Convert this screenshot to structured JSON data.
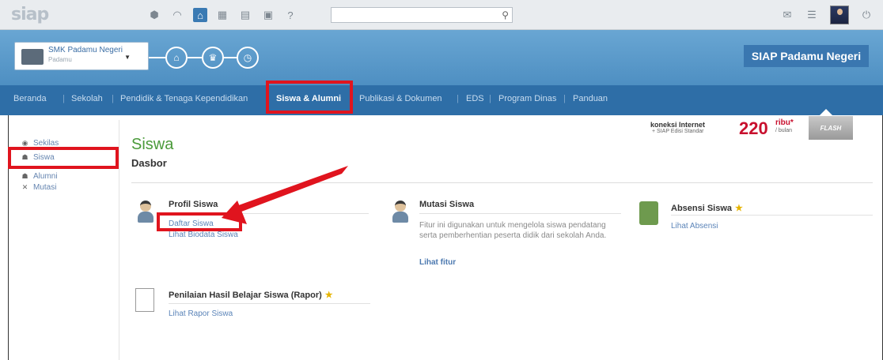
{
  "topbar": {
    "logo": "siap",
    "icons": [
      "cube-icon",
      "rss-icon",
      "org-icon",
      "grid-icon",
      "table-icon",
      "calendar-icon",
      "help-icon"
    ],
    "search_placeholder": "",
    "right_icons": [
      "mail-icon",
      "list-icon",
      "user-avatar",
      "power-icon"
    ]
  },
  "header": {
    "school_name": "SMK Padamu Negeri",
    "school_sub": "Padamu",
    "brand": "SIAP Padamu Negeri"
  },
  "nav": {
    "items": [
      "Beranda",
      "Sekolah",
      "Pendidik & Tenaga Kependidikan",
      "Siswa & Alumni",
      "Publikasi & Dokumen",
      "EDS",
      "Program Dinas",
      "Panduan"
    ],
    "active": "Siswa & Alumni"
  },
  "sidebar": {
    "items": [
      {
        "label": "Sekilas",
        "icon": "info-icon"
      },
      {
        "label": "Siswa",
        "icon": "student-icon"
      },
      {
        "label": "Alumni",
        "icon": "alumni-icon"
      },
      {
        "label": "Mutasi",
        "icon": "transfer-icon"
      }
    ]
  },
  "main": {
    "title": "Siswa",
    "subtitle": "Dasbor"
  },
  "promo": {
    "line1": "koneksi Internet",
    "line2": "+ SIAP Edisi Standar",
    "price": "220",
    "unit": "ribu*",
    "per": "/ bulan",
    "flash": "FLASH"
  },
  "cards": {
    "profil": {
      "title": "Profil Siswa",
      "links": [
        "Daftar Siswa",
        "Lihat Biodata Siswa"
      ]
    },
    "mutasi": {
      "title": "Mutasi Siswa",
      "desc": "Fitur ini digunakan untuk mengelola siswa pendatang serta pemberhentian peserta didik dari sekolah Anda.",
      "link": "Lihat fitur"
    },
    "absensi": {
      "title": "Absensi Siswa",
      "link": "Lihat Absensi"
    },
    "rapor": {
      "title": "Penilaian Hasil Belajar Siswa (Rapor)",
      "link": "Lihat Rapor Siswa"
    }
  },
  "colors": {
    "accent": "#2e6ea7",
    "highlight": "#e0141e",
    "title_green": "#4a9a3a"
  }
}
